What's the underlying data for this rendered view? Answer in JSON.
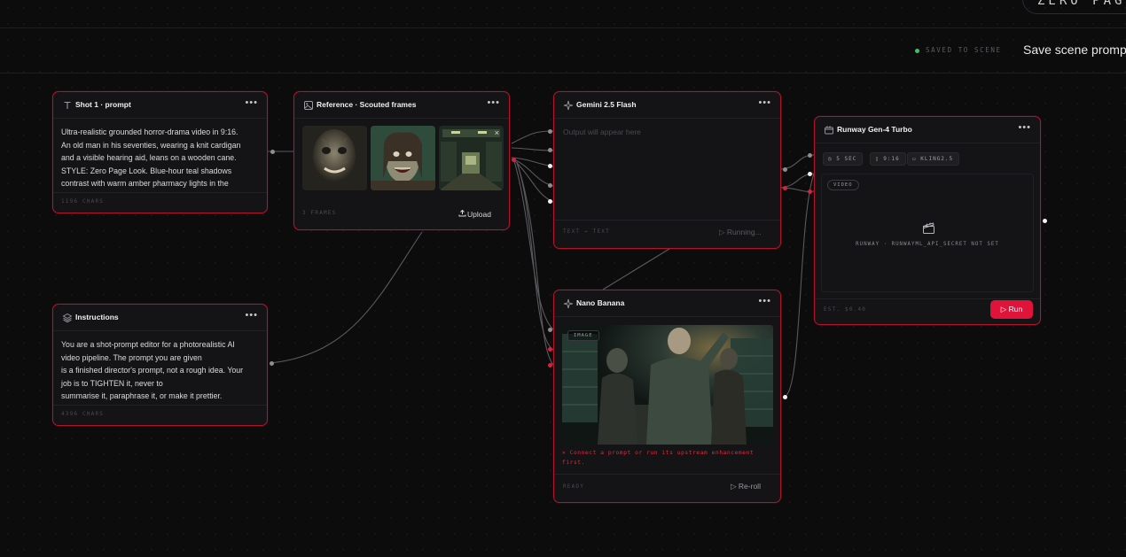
{
  "header": {
    "brand": "ZERO PAGE L",
    "saved_status": "SAVED TO SCENE",
    "save_button": "Save scene prompt"
  },
  "colors": {
    "accent": "#e0143a",
    "node_border": "#b3142c",
    "saved_dot": "#3fbf6a"
  },
  "nodes": {
    "shot": {
      "icon": "text-icon",
      "title": "Shot 1 · prompt",
      "lines": [
        "Ultra-realistic grounded horror-drama video in 9:16.",
        "An old man in his seventies, wearing a knit cardigan",
        "and a visible hearing aid, leans on a wooden cane.",
        "STYLE: Zero Page Look. Blue-hour teal shadows",
        "contrast with warm amber pharmacy lights in the"
      ],
      "meta": "1196 CHARS"
    },
    "reference": {
      "icon": "image-grid-icon",
      "title": "Reference · Scouted frames",
      "meta": "3 FRAMES",
      "upload_label": "Upload",
      "remove_label": "×"
    },
    "gemini": {
      "icon": "sparkle-icon",
      "title": "Gemini 2.5 Flash",
      "placeholder": "Output will appear here",
      "meta": "TEXT → TEXT",
      "status": "Running..."
    },
    "instructions": {
      "icon": "layers-icon",
      "title": "Instructions",
      "lines": [
        "You are a shot-prompt editor for a photorealistic AI",
        "video pipeline. The prompt you are given",
        "is a finished director's prompt, not a rough idea. Your",
        "job is to TIGHTEN it, never to",
        "summarise it, paraphrase it, or make it prettier."
      ],
      "meta": "4396 CHARS"
    },
    "nano": {
      "icon": "sparkle-icon",
      "title": "Nano Banana",
      "badge": "IMAGE",
      "error_lines": [
        "× Connect a prompt or run its upstream enhancement",
        "first."
      ],
      "meta": "READY",
      "reroll_label": "Re-roll"
    },
    "runway": {
      "icon": "film-icon",
      "title": "Runway Gen-4 Turbo",
      "chips": [
        "5 SEC",
        "9:16",
        "KLING2.5"
      ],
      "tag": "VIDEO",
      "message": "RUNWAY · RUNWAYML_API_SECRET NOT SET",
      "meta": "EST. $0.40",
      "run_label": "Run"
    }
  }
}
